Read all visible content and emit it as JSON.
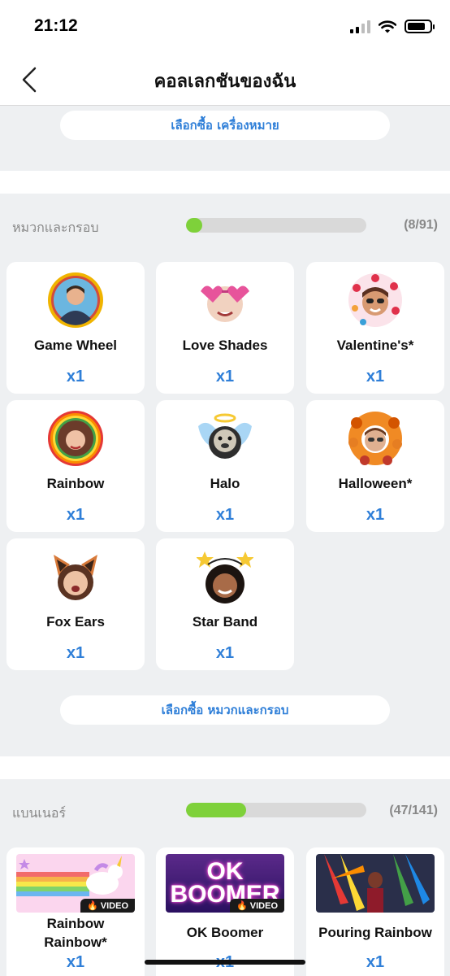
{
  "status": {
    "time": "21:12"
  },
  "nav": {
    "title": "คอลเลกชันของฉัน",
    "back_icon": "chevron-left-icon"
  },
  "buy_devices_label": "เลือกซื้อ เครื่องหมาย",
  "frames": {
    "title": "หมวกและกรอบ",
    "count": "(8/91)",
    "progress": 0.088,
    "buy_label": "เลือกซื้อ หมวกและกรอบ",
    "items": [
      {
        "name": "Game Wheel",
        "qty": "x1"
      },
      {
        "name": "Love Shades",
        "qty": "x1"
      },
      {
        "name": "Valentine's*",
        "qty": "x1"
      },
      {
        "name": "Rainbow",
        "qty": "x1"
      },
      {
        "name": "Halo",
        "qty": "x1"
      },
      {
        "name": "Halloween*",
        "qty": "x1"
      },
      {
        "name": "Fox Ears",
        "qty": "x1"
      },
      {
        "name": "Star Band",
        "qty": "x1"
      }
    ]
  },
  "banners": {
    "title": "แบนเนอร์",
    "count": "(47/141)",
    "progress": 0.333,
    "items": [
      {
        "name": "Rainbow Rainbow*",
        "qty": "x1",
        "tag": "VIDEO"
      },
      {
        "name": "OK Boomer",
        "qty": "x1",
        "tag": "VIDEO",
        "art_text": "OK BOOMER"
      },
      {
        "name": "Pouring Rainbow",
        "qty": "x1"
      }
    ]
  },
  "colors": {
    "accent": "#2f7fd8",
    "progress": "#7ed13a"
  }
}
